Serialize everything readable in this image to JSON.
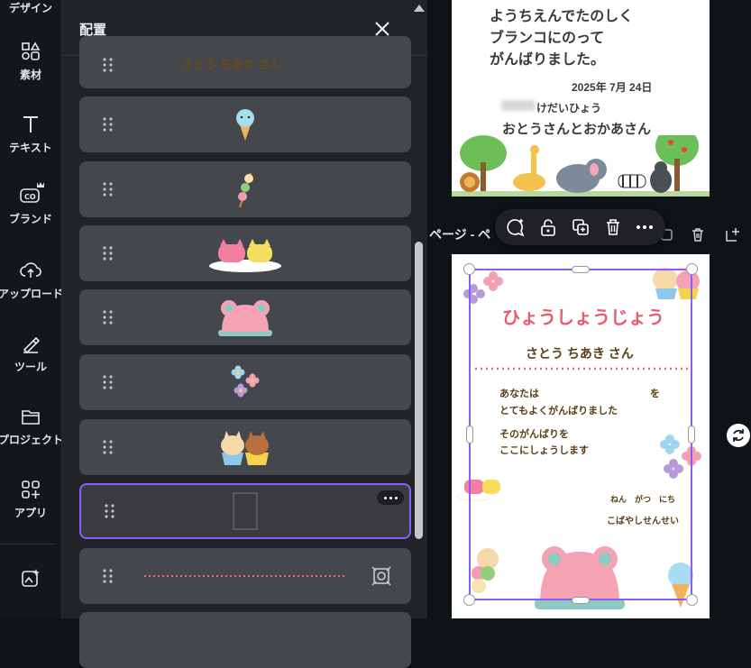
{
  "rail": {
    "items": [
      {
        "label": "デザイン",
        "icon": "design-icon"
      },
      {
        "label": "素材",
        "icon": "elements-icon"
      },
      {
        "label": "テキスト",
        "icon": "text-icon"
      },
      {
        "label": "ブランド",
        "icon": "brand-icon"
      },
      {
        "label": "アップロード",
        "icon": "upload-icon"
      },
      {
        "label": "ツール",
        "icon": "tools-icon"
      },
      {
        "label": "プロジェクト",
        "icon": "folder-icon"
      },
      {
        "label": "アプリ",
        "icon": "apps-icon"
      }
    ]
  },
  "panel": {
    "title": "配置",
    "layers": [
      {
        "name": "text-name",
        "thumb": "さとう ちあき さん"
      },
      {
        "name": "ice-cream"
      },
      {
        "name": "dango"
      },
      {
        "name": "macarons"
      },
      {
        "name": "frog-hat"
      },
      {
        "name": "flowers"
      },
      {
        "name": "cupcakes"
      },
      {
        "name": "frame",
        "selected": true
      },
      {
        "name": "dotted-line"
      },
      {
        "name": "partial"
      }
    ]
  },
  "page1": {
    "lines": [
      "ようちえんでたのしく",
      "ブランコにのって",
      "がんばりました。"
    ],
    "date": "2025年 7月 24日",
    "from_label": "けだいひょう",
    "from": "おとうさんとおかあさん"
  },
  "page_label": "ページ - ペ",
  "page2": {
    "title": "ひょうしょうじょう",
    "name": "さとう ちあき さん",
    "body1_a": "あなたは",
    "body1_b": "を",
    "body2": "とてもよくがんばりました",
    "body3": "そのがんばりを",
    "body4": "ここにしょうします",
    "date": "ねん　がつ　にち",
    "teacher": "こばやしせんせい"
  },
  "colors": {
    "accent": "#8b5cf6",
    "title_pink": "#e85a6d",
    "text_brown": "#5b3e14"
  }
}
